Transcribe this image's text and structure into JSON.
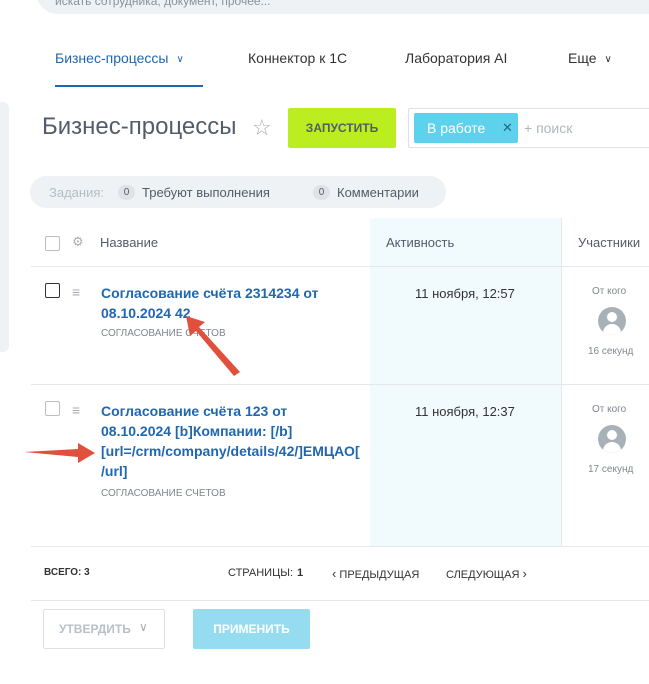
{
  "search": {
    "placeholder": "искать сотрудника, документ, прочее..."
  },
  "nav": {
    "items": [
      {
        "label": "Бизнес-процессы",
        "active": true,
        "has_menu": true
      },
      {
        "label": "Коннектор к 1С",
        "active": false,
        "has_menu": false
      },
      {
        "label": "Лаборатория AI",
        "active": false,
        "has_menu": false
      },
      {
        "label": "Еще",
        "active": false,
        "has_menu": true
      }
    ]
  },
  "header": {
    "title": "Бизнес-процессы",
    "launch_label": "ЗАПУСТИТЬ",
    "filter_chip": "В работе",
    "filter_placeholder": "+ поиск"
  },
  "counters": {
    "label": "Задания:",
    "items": [
      {
        "count": "0",
        "text": "Требуют выполнения"
      },
      {
        "count": "0",
        "text": "Комментарии"
      }
    ]
  },
  "table": {
    "columns": {
      "name": "Название",
      "activity": "Активность",
      "participants": "Участники"
    },
    "rows": [
      {
        "title": "Согласование счёта 2314234 от 08.10.2024 42",
        "subtitle": "СОГЛАСОВАНИЕ СЧЕТОВ",
        "date": "11 ноября, 12:57",
        "from_label": "От кого",
        "ago": "16 секунд"
      },
      {
        "title": "Согласование счёта 123 от 08.10.2024 [b]Компании: [/b] [url=/crm/company/details/42/]ЕМЦАО[/url]",
        "subtitle": "СОГЛАСОВАНИЕ СЧЕТОВ",
        "date": "11 ноября, 12:37",
        "from_label": "От кого",
        "ago": "17 секунд"
      }
    ]
  },
  "footer": {
    "total_label": "ВСЕГО: 3",
    "pages_label": "СТРАНИЦЫ:",
    "page_number": "1",
    "prev_label": "ПРЕДЫДУЩАЯ",
    "next_label": "СЛЕДУЮЩАЯ",
    "approve_label": "УТВЕРДИТЬ",
    "apply_label": "ПРИМЕНИТЬ"
  },
  "colors": {
    "accent": "#2067b0",
    "launch": "#bbed21",
    "chip": "#5ed1ec",
    "activity_column": "#f1fbfe",
    "annotation_arrow": "#e0503c"
  }
}
